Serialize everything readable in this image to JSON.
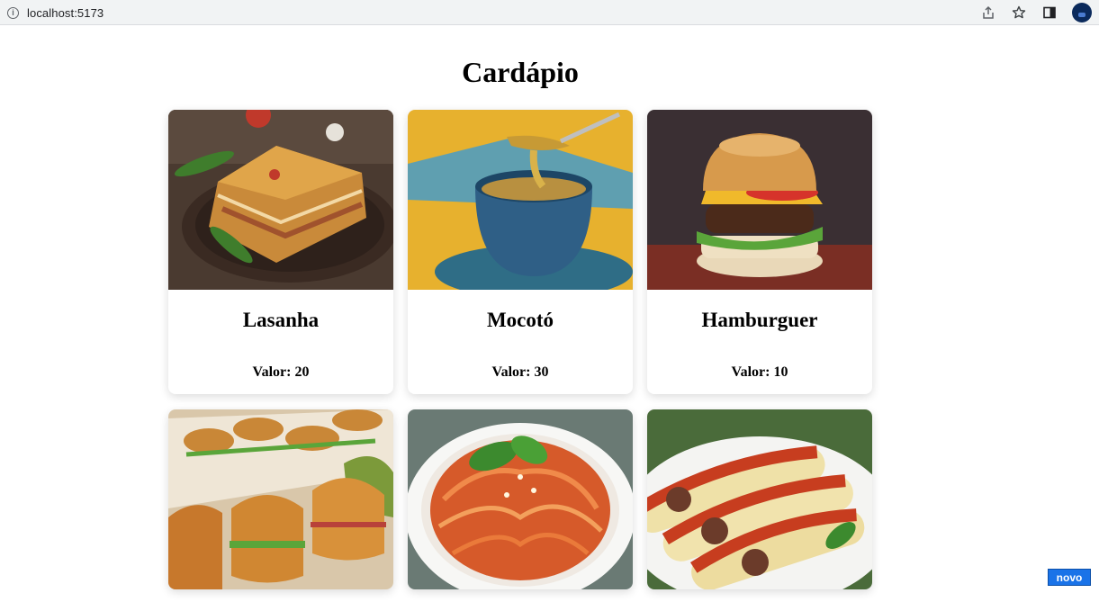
{
  "browser": {
    "url": "localhost:5173",
    "icons": [
      "info-icon",
      "share-icon",
      "star-icon",
      "side-panel-icon",
      "profile-avatar"
    ]
  },
  "page": {
    "title": "Cardápio"
  },
  "menu": {
    "items": [
      {
        "name": "Lasanha",
        "price": "Valor: 20",
        "image": "lasagna-photo"
      },
      {
        "name": "Mocotó",
        "price": "Valor: 30",
        "image": "soup-bowl-photo"
      },
      {
        "name": "Hamburguer",
        "price": "Valor: 10",
        "image": "burger-photo"
      },
      {
        "name": "",
        "price": "",
        "image": "sandwiches-photo"
      },
      {
        "name": "",
        "price": "",
        "image": "spaghetti-photo"
      },
      {
        "name": "",
        "price": "",
        "image": "cannelloni-photo"
      }
    ]
  },
  "badge": {
    "label": "novo"
  },
  "colors": {
    "badge": "#1a73e8",
    "chrome": "#f1f3f4"
  }
}
